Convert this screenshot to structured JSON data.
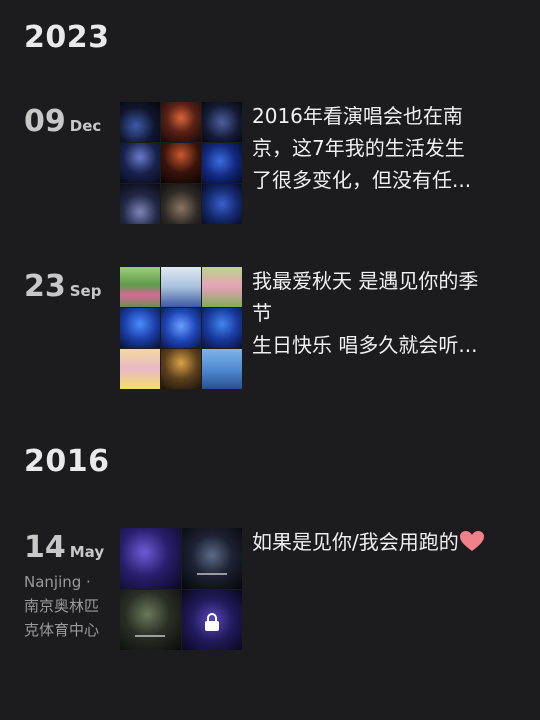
{
  "sections": [
    {
      "year": "2023",
      "entries": [
        {
          "day": "09",
          "month": "Dec",
          "text_lines": [
            "2016年看演唱会也在南",
            "京，这7年我的生活发生",
            "了很多变化，但没有任..."
          ]
        },
        {
          "day": "23",
          "month": "Sep",
          "text_lines": [
            "我最爱秋天  是遇见你的季",
            "节",
            "生日快乐  唱多久就会听..."
          ]
        }
      ]
    },
    {
      "year": "2016",
      "entries": [
        {
          "day": "14",
          "month": "May",
          "location_lines": [
            "Nanjing ·",
            "南京奥林匹",
            "克体育中心"
          ],
          "text_lines": [
            "如果是见你/我会用跑的"
          ],
          "emoji": "heart-emoji",
          "locked_photo_icon": "lock-icon"
        }
      ]
    }
  ],
  "colors": {
    "background": "#1c1c1e",
    "text": "#f0f0f0",
    "secondary": "#9a9a9a",
    "heart": "#f0808a"
  }
}
